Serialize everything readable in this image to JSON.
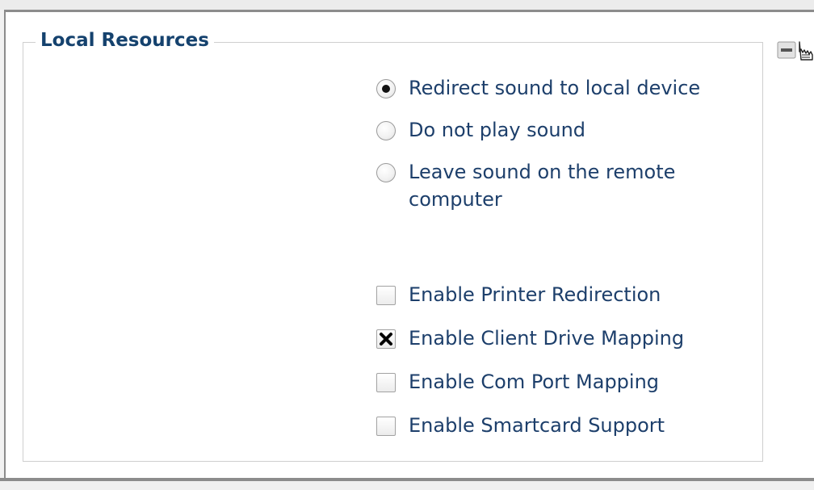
{
  "group": {
    "title": "Local Resources"
  },
  "sound": {
    "options": [
      {
        "label": "Redirect sound to local device",
        "selected": true
      },
      {
        "label": "Do not play sound",
        "selected": false
      },
      {
        "label": "Leave sound on the remote computer",
        "selected": false
      }
    ]
  },
  "redirection": {
    "options": [
      {
        "label": "Enable Printer Redirection",
        "checked": false
      },
      {
        "label": "Enable Client Drive Mapping",
        "checked": true
      },
      {
        "label": "Enable Com Port Mapping",
        "checked": false
      },
      {
        "label": "Enable Smartcard Support",
        "checked": false
      }
    ]
  },
  "icons": {
    "collapse": "collapse-minus-icon",
    "cursor": "hand-pointer-cursor-icon"
  }
}
